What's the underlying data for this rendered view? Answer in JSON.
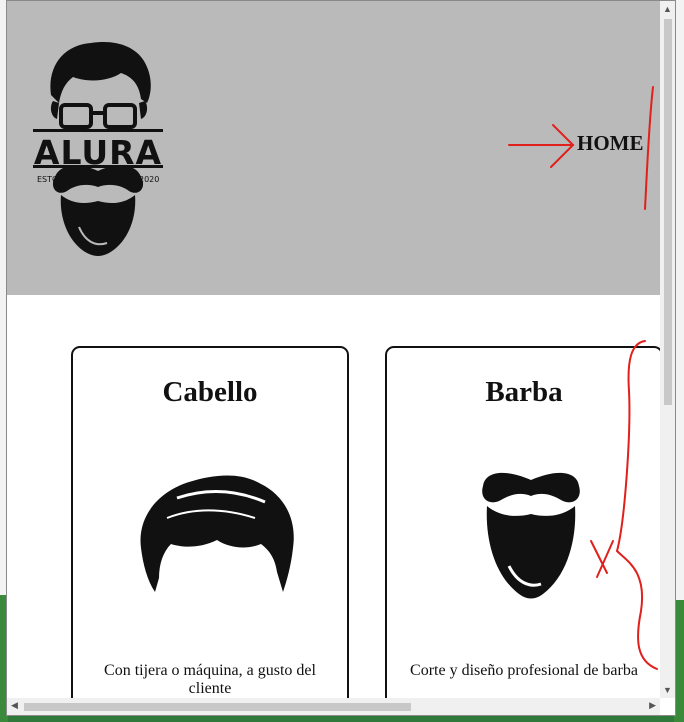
{
  "header": {
    "logo": {
      "brand": "ALURA",
      "est_left": "ESTO",
      "est_right": "2020"
    },
    "nav": {
      "home_label": "HOME"
    },
    "background_color": "#bababa"
  },
  "services": [
    {
      "title": "Cabello",
      "description": "Con tijera o máquina, a gusto del cliente",
      "icon": "hair-icon"
    },
    {
      "title": "Barba",
      "description": "Corte y diseño profesional de barba",
      "icon": "beard-icon"
    }
  ],
  "annotations": {
    "color": "#e0201c"
  },
  "scrollbars": {
    "up_arrow": "▲",
    "down_arrow": "▼",
    "left_arrow": "◀",
    "right_arrow": "▶"
  }
}
